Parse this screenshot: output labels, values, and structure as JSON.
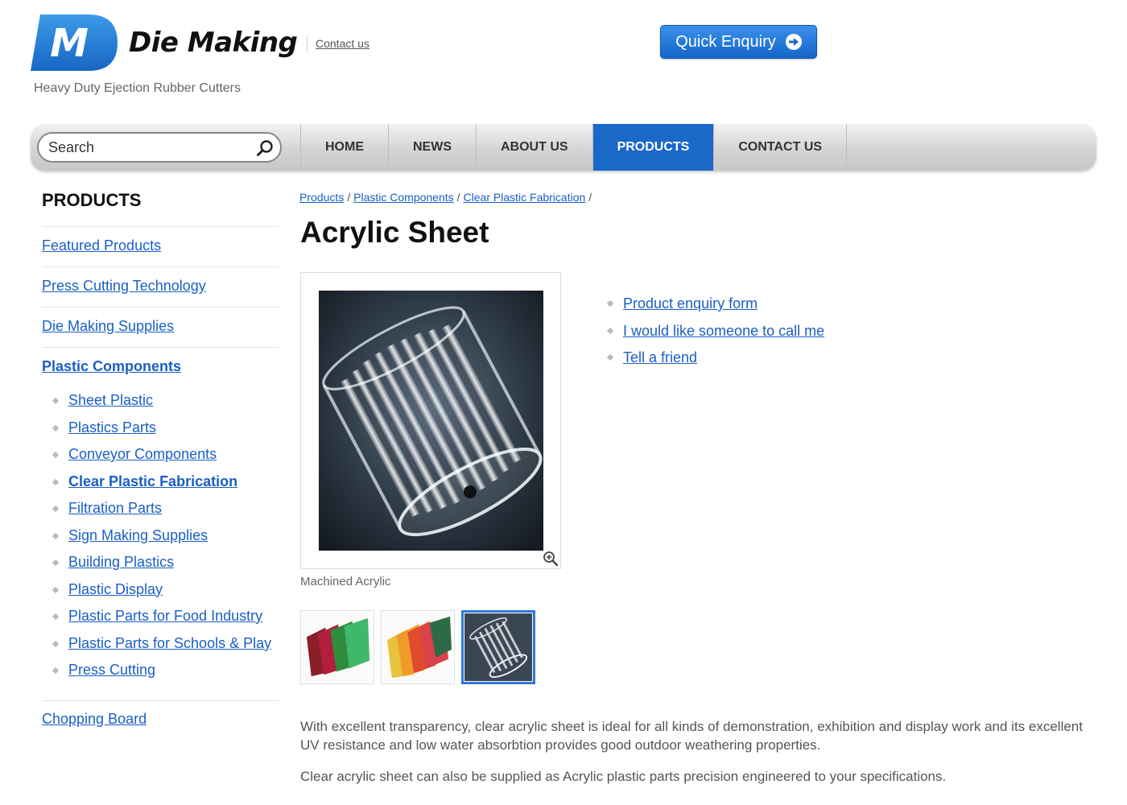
{
  "header": {
    "logo_letter": "M",
    "logo_name": "Die Making",
    "tagline": "Heavy Duty Ejection Rubber Cutters",
    "contact_link": "Contact us",
    "quick_enquiry": "Quick Enquiry"
  },
  "nav": {
    "search_placeholder": "Search",
    "items": [
      "HOME",
      "NEWS",
      "ABOUT US",
      "PRODUCTS",
      "CONTACT US"
    ],
    "active": "PRODUCTS"
  },
  "sidebar": {
    "title": "PRODUCTS",
    "items": [
      "Featured Products",
      "Press Cutting Technology",
      "Die Making Supplies",
      "Plastic Components"
    ],
    "current_section": "Plastic Components",
    "sub_items": [
      "Sheet Plastic",
      "Plastics Parts",
      "Conveyor Components",
      "Clear Plastic Fabrication",
      "Filtration Parts",
      "Sign Making Supplies",
      "Building Plastics",
      "Plastic Display",
      "Plastic Parts for Food Industry",
      "Plastic Parts for Schools & Play",
      "Press Cutting"
    ],
    "current_sub": "Clear Plastic Fabrication",
    "bottom_item": "Chopping Board"
  },
  "breadcrumb": [
    "Products",
    "Plastic Components",
    "Clear Plastic Fabrication"
  ],
  "product": {
    "title": "Acrylic Sheet",
    "caption": "Machined Acrylic",
    "actions": [
      "Product enquiry form",
      "I would like someone to call me",
      "Tell a friend"
    ],
    "description": [
      "With excellent transparency, clear acrylic sheet is ideal for all kinds of demonstration, exhibition and display work and its excellent UV resistance and low water absorbtion provides good outdoor weathering properties.",
      "Clear acrylic sheet can also be supplied as Acrylic plastic parts precision engineered to your specifications."
    ]
  },
  "colors": {
    "brand_blue": "#1a68c8",
    "link": "#1a5fc4"
  }
}
